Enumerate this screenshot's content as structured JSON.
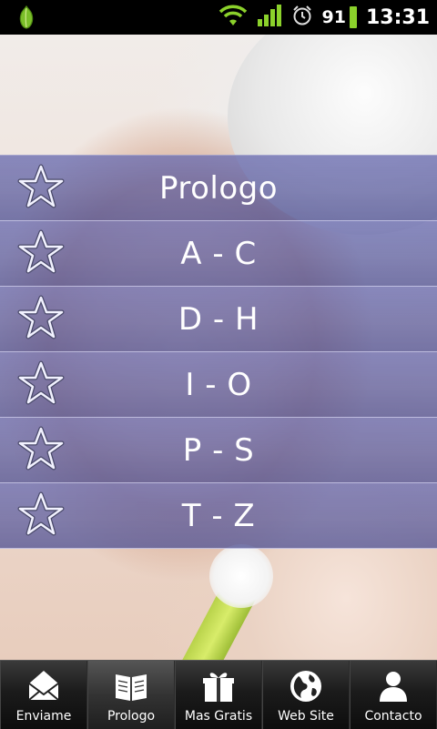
{
  "status_bar": {
    "battery_level": "91",
    "time": "13:31"
  },
  "menu": {
    "items": [
      {
        "label": "Prologo"
      },
      {
        "label": "A - C"
      },
      {
        "label": "D - H"
      },
      {
        "label": "I - O"
      },
      {
        "label": "P - S"
      },
      {
        "label": "T - Z"
      }
    ]
  },
  "tab_bar": {
    "tabs": [
      {
        "label": "Enviame",
        "icon": "envelope-icon"
      },
      {
        "label": "Prologo",
        "icon": "book-icon"
      },
      {
        "label": "Mas Gratis",
        "icon": "gift-icon"
      },
      {
        "label": "Web Site",
        "icon": "globe-icon"
      },
      {
        "label": "Contacto",
        "icon": "person-icon"
      }
    ]
  },
  "colors": {
    "menu_overlay": "#5c5ea0",
    "status_bar_bg": "#000000",
    "battery_green": "#8bd12b",
    "tab_bar_bg": "#1b1b1b"
  }
}
